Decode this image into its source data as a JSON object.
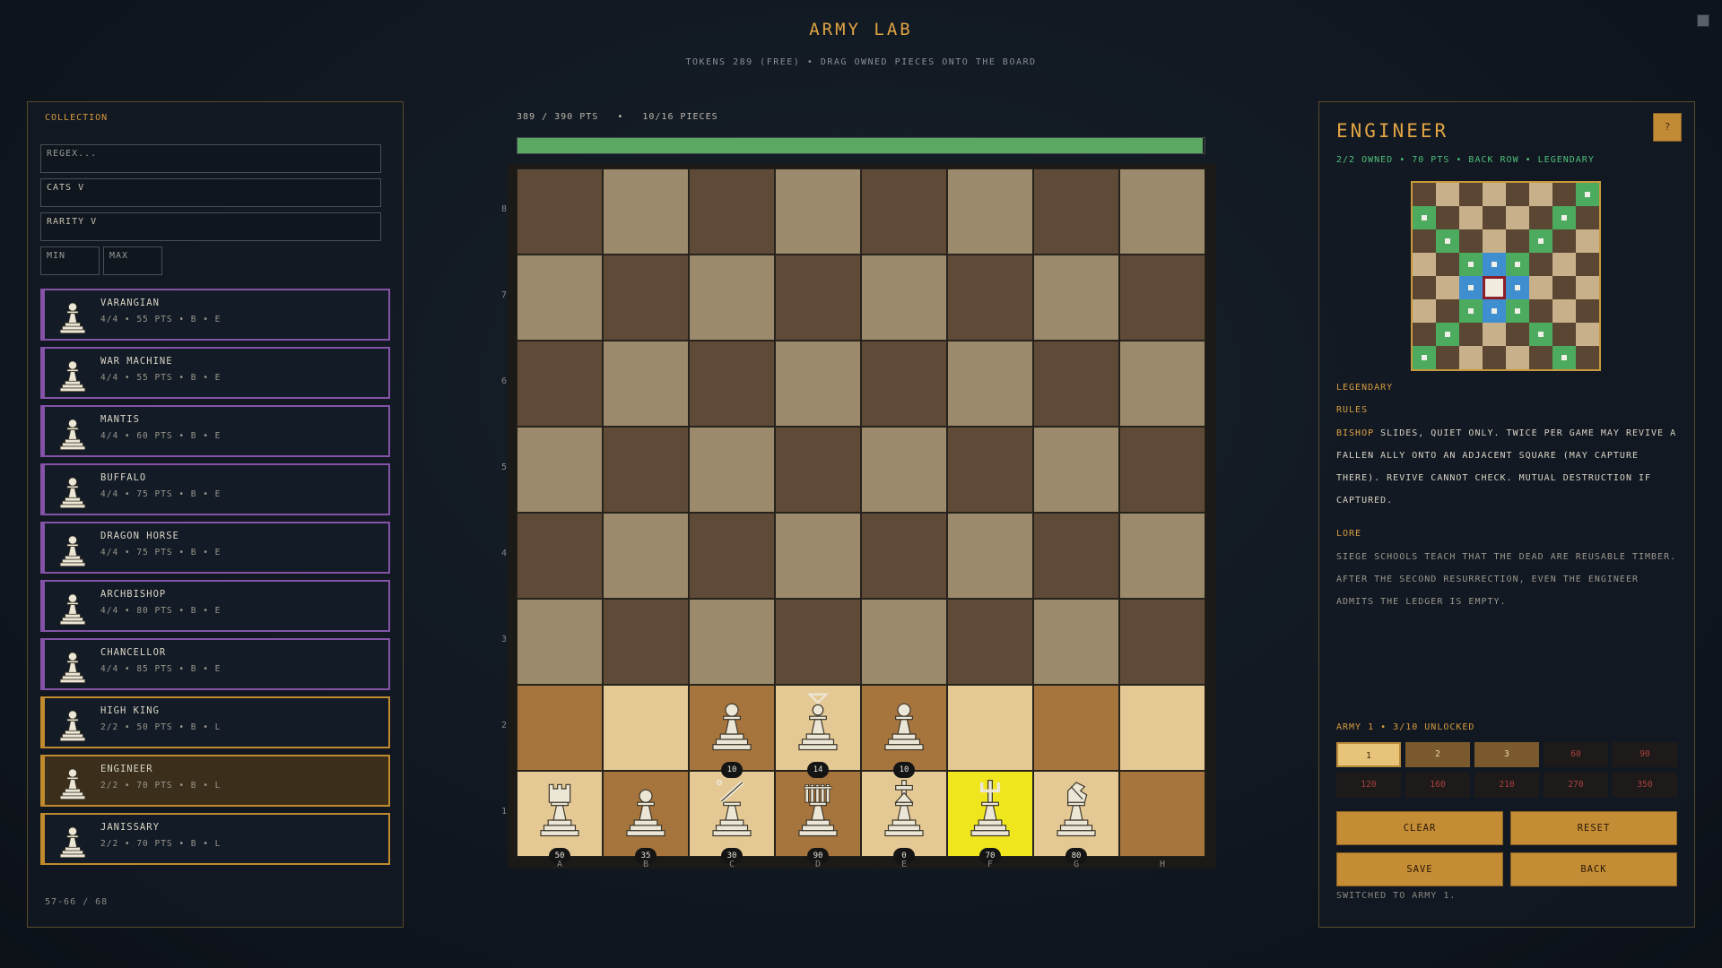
{
  "header": {
    "title": "ARMY LAB",
    "subtitle": "TOKENS 289 (FREE)  •  DRAG OWNED PIECES ONTO THE BOARD"
  },
  "collection": {
    "title": "COLLECTION",
    "search_placeholder": "REGEX...",
    "cats_label": "CATS V",
    "rarity_label": "RARITY V",
    "min_placeholder": "MIN",
    "max_placeholder": "MAX",
    "footer": "57-66 / 68",
    "items": [
      {
        "name": "VARANGIAN",
        "meta": "4/4 • 55 PTS • B • E",
        "rarity": "epic",
        "icon": "flag-pawn-icon"
      },
      {
        "name": "WAR MACHINE",
        "meta": "4/4 • 55 PTS • B • E",
        "rarity": "epic",
        "icon": "sun-pawn-icon"
      },
      {
        "name": "MANTIS",
        "meta": "4/4 • 60 PTS • B • E",
        "rarity": "epic",
        "icon": "mantis-pawn-icon"
      },
      {
        "name": "BUFFALO",
        "meta": "4/4 • 75 PTS • B • E",
        "rarity": "epic",
        "icon": "horns-pawn-icon"
      },
      {
        "name": "DRAGON HORSE",
        "meta": "4/4 • 75 PTS • B • E",
        "rarity": "epic",
        "icon": "dragon-pawn-icon"
      },
      {
        "name": "ARCHBISHOP",
        "meta": "4/4 • 80 PTS • B • E",
        "rarity": "epic",
        "icon": "archbishop-pawn-icon"
      },
      {
        "name": "CHANCELLOR",
        "meta": "4/4 • 85 PTS • B • E",
        "rarity": "epic",
        "icon": "crown-pawn-icon"
      },
      {
        "name": "HIGH KING",
        "meta": "2/2 • 50 PTS • B • L",
        "rarity": "legendary",
        "icon": "cross-pawn-icon"
      },
      {
        "name": "ENGINEER",
        "meta": "2/2 • 70 PTS • B • L",
        "rarity": "legendary",
        "icon": "staff-pawn-icon",
        "selected": true
      },
      {
        "name": "JANISSARY",
        "meta": "2/2 • 70 PTS • B • L",
        "rarity": "legendary",
        "icon": "helmet-pawn-icon"
      }
    ]
  },
  "board": {
    "points_text": "389 / 390 PTS",
    "separator": "•",
    "pieces_text": "10/16 PIECES",
    "points_used": 389,
    "points_max": 390,
    "ranks": [
      "8",
      "7",
      "6",
      "5",
      "4",
      "3",
      "2",
      "1"
    ],
    "files": [
      "A",
      "B",
      "C",
      "D",
      "E",
      "F",
      "G",
      "H"
    ],
    "pieces": [
      {
        "square": "A1",
        "type": "rook",
        "badge": "50"
      },
      {
        "square": "B1",
        "type": "pawn",
        "badge": "35"
      },
      {
        "square": "C1",
        "type": "slash",
        "badge": "30"
      },
      {
        "square": "D1",
        "type": "palisade",
        "badge": "90"
      },
      {
        "square": "E1",
        "type": "cross",
        "badge": "0"
      },
      {
        "square": "F1",
        "type": "staff",
        "badge": "70",
        "highlight": true
      },
      {
        "square": "G1",
        "type": "knight",
        "badge": "80"
      },
      {
        "square": "C2",
        "type": "pawn",
        "badge": "10"
      },
      {
        "square": "D2",
        "type": "chevron",
        "badge": "14"
      },
      {
        "square": "E2",
        "type": "pawn",
        "badge": "10"
      }
    ],
    "colors": {
      "dark_top": "#5e4a36",
      "light_top": "#9b8a6c",
      "dark_home": "#a6753e",
      "light_home": "#e5c994",
      "highlight": "#f0e61e"
    }
  },
  "detail": {
    "name": "ENGINEER",
    "help_label": "?",
    "meta": "2/2 OWNED • 70 PTS • BACK ROW • LEGENDARY",
    "rarity": "LEGENDARY",
    "rules_heading": "RULES",
    "rules_keyword": "BISHOP",
    "rules_line1": " SLIDES, QUIET ONLY. TWICE PER GAME MAY REVIVE A",
    "rules_line2": " FALLEN ALLY ONTO AN ADJACENT SQUARE (MAY CAPTURE",
    "rules_line3": "THERE). REVIVE CANNOT CHECK. MUTUAL DESTRUCTION IF",
    "rules_line4": "CAPTURED.",
    "lore_heading": "LORE",
    "lore_line1": "SIEGE SCHOOLS TEACH THAT THE DEAD ARE REUSABLE TIMBER.",
    "lore_line2": " AFTER THE SECOND RESURRECTION, EVEN THE ENGINEER",
    "lore_line3": "ADMITS THE LEDGER IS EMPTY.",
    "move_grid": {
      "green": [
        [
          0,
          7
        ],
        [
          1,
          0
        ],
        [
          1,
          6
        ],
        [
          2,
          1
        ],
        [
          2,
          5
        ],
        [
          3,
          2
        ],
        [
          3,
          4
        ],
        [
          5,
          2
        ],
        [
          5,
          4
        ],
        [
          6,
          1
        ],
        [
          6,
          5
        ],
        [
          7,
          0
        ],
        [
          7,
          6
        ]
      ],
      "blue": [
        [
          3,
          3
        ],
        [
          4,
          2
        ],
        [
          4,
          4
        ],
        [
          5,
          3
        ]
      ],
      "center": [
        4,
        3
      ]
    }
  },
  "army": {
    "label": "ARMY 1  •  3/10 UNLOCKED",
    "slots": [
      {
        "label": "1",
        "state": "active"
      },
      {
        "label": "2",
        "state": "unlocked"
      },
      {
        "label": "3",
        "state": "unlocked"
      },
      {
        "label": "60",
        "state": "locked"
      },
      {
        "label": "90",
        "state": "locked"
      },
      {
        "label": "120",
        "state": "locked"
      },
      {
        "label": "160",
        "state": "locked"
      },
      {
        "label": "210",
        "state": "locked"
      },
      {
        "label": "270",
        "state": "locked"
      },
      {
        "label": "350",
        "state": "locked"
      }
    ],
    "buttons": {
      "clear": "CLEAR",
      "reset": "RESET",
      "save": "SAVE",
      "back": "BACK"
    },
    "status": "SWITCHED TO ARMY 1."
  }
}
